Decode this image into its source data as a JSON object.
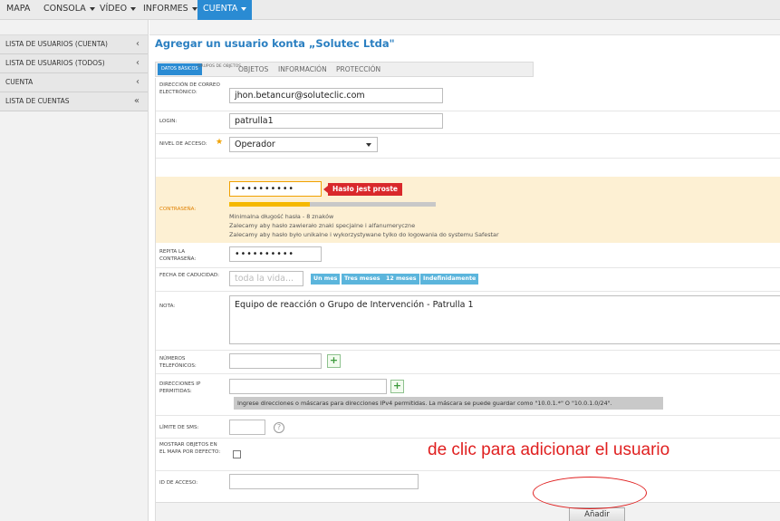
{
  "nav": {
    "items": [
      {
        "label": "MAPA",
        "caret": false
      },
      {
        "label": "CONSOLA",
        "caret": true
      },
      {
        "label": "VÍDEO",
        "caret": true
      },
      {
        "label": "INFORMES",
        "caret": true
      },
      {
        "label": "CUENTA",
        "caret": true,
        "active": true
      }
    ]
  },
  "sidebar": {
    "items": [
      {
        "label": "LISTA DE USUARIOS (CUENTA)",
        "arrow": "‹"
      },
      {
        "label": "LISTA DE USUARIOS (TODOS)",
        "arrow": "‹"
      },
      {
        "label": "CUENTA",
        "arrow": "‹"
      },
      {
        "label": "LISTA DE CUENTAS",
        "arrow": "«"
      }
    ]
  },
  "page": {
    "title": "Agregar un usuario konta „Solutec Ltda\""
  },
  "tabs": {
    "active": "DATOS BÁSICOS",
    "small": "GRUPOS DE OBJETOS",
    "items": [
      "OBJETOS",
      "INFORMACIÓN",
      "PROTECCIÓN"
    ]
  },
  "form": {
    "email": {
      "label": "DIRECCIÓN DE CORREO ELECTRÓNICO:",
      "value": "jhon.betancur@soluteclic.com"
    },
    "login": {
      "label": "LOGIN:",
      "value": "patrulla1"
    },
    "access": {
      "label": "NIVEL DE ACCESO:",
      "value": "Operador"
    },
    "password": {
      "label": "CONTRASEÑA:",
      "value": "••••••••••",
      "badge": "Hasło jest proste",
      "strength": 0.39,
      "hints": [
        "Minimalna długość hasła - 8 znaków",
        "Zalecamy aby hasło zawierało znaki specjalne i alfanumeryczne",
        "Zalecamy aby hasło było unikalne i wykorzystywane tylko do logowania do systemu Safestar"
      ]
    },
    "repeat_password": {
      "label": "REPITA LA CONTRASEÑA:",
      "value": "••••••••••"
    },
    "expiry": {
      "label": "FECHA DE CADUCIDAD:",
      "placeholder": "toda la vida...",
      "chips": [
        "Un mes",
        "Tres meses",
        "12 meses",
        "Indefinidamente"
      ]
    },
    "note": {
      "label": "NOTA:",
      "value": "Equipo de reacción o Grupo de Intervención - Patrulla 1"
    },
    "phones": {
      "label": "NÚMEROS TELEFÓNICOS:",
      "button": "+"
    },
    "ips": {
      "label": "DIRECCIONES IP PERMITIDAS:",
      "button": "+",
      "hint": "Ingrese direcciones o máscaras para direcciones IPv4 permitidas. La máscara se puede guardar como \"10.0.1.*\" O \"10.0.1.0/24\"."
    },
    "sms": {
      "label": "LÍMITE DE SMS:",
      "help": "?"
    },
    "show_objects": {
      "label": "MOSTRAR OBJETOS EN EL MAPA POR DEFECTO:"
    },
    "access_id": {
      "label": "ID DE ACCESO:"
    },
    "submit_label": "Añadir"
  },
  "annotation": {
    "text": "de clic para adicionar el usuario"
  },
  "colors": {
    "accent": "#2a8bd3",
    "title": "#2a7fc1",
    "pw_panel": "#fdf0d3",
    "error_badge": "#d9282b",
    "chip": "#5bb5dc",
    "annotation": "#e02020"
  }
}
